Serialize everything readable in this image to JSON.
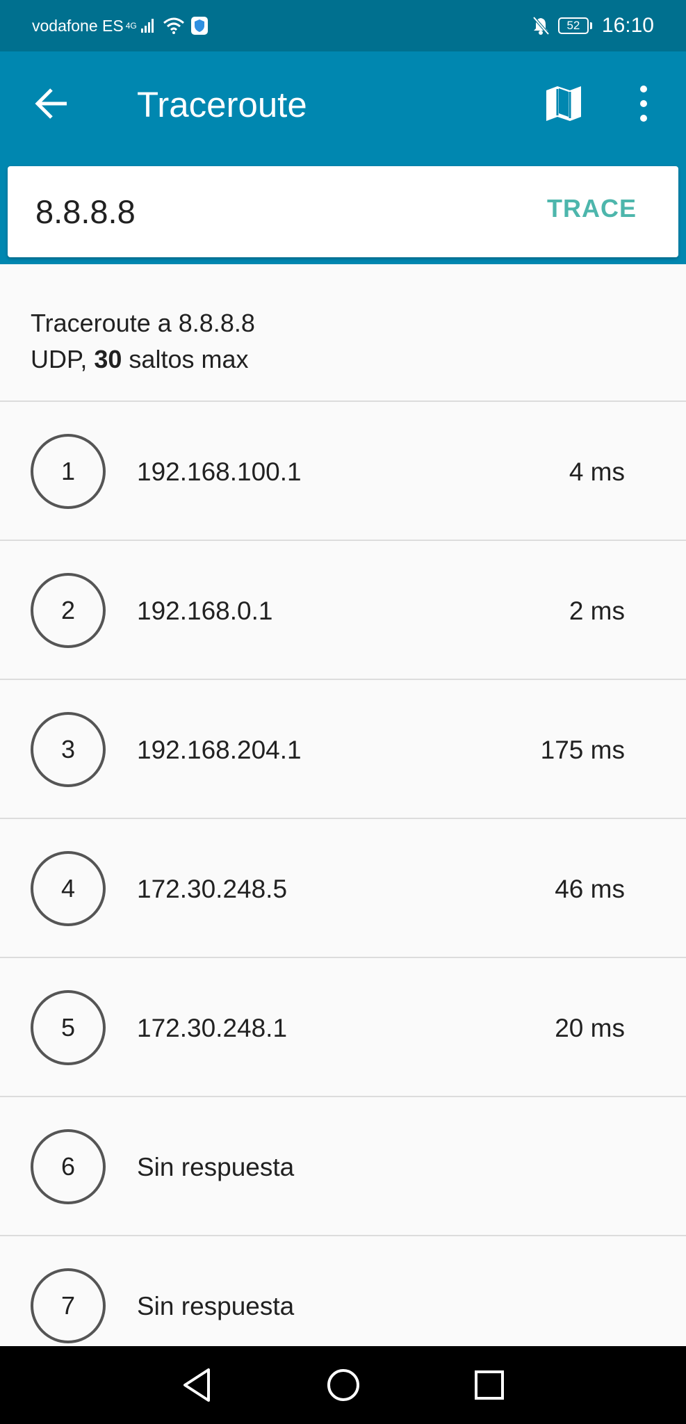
{
  "status_bar": {
    "carrier": "vodafone ES",
    "network_type": "4G",
    "battery": "52",
    "time": "16:10"
  },
  "app_bar": {
    "title": "Traceroute"
  },
  "query": {
    "host_value": "8.8.8.8",
    "trace_label": "TRACE"
  },
  "summary": {
    "title": "Traceroute a 8.8.8.8",
    "protocol": "UDP, ",
    "max_hops": "30",
    "max_hops_suffix": " saltos max"
  },
  "hops": [
    {
      "number": "1",
      "host": "192.168.100.1",
      "time": "4 ms"
    },
    {
      "number": "2",
      "host": "192.168.0.1",
      "time": "2 ms"
    },
    {
      "number": "3",
      "host": "192.168.204.1",
      "time": "175 ms"
    },
    {
      "number": "4",
      "host": "172.30.248.5",
      "time": "46 ms"
    },
    {
      "number": "5",
      "host": "172.30.248.1",
      "time": "20 ms"
    },
    {
      "number": "6",
      "host": "Sin respuesta",
      "time": ""
    },
    {
      "number": "7",
      "host": "Sin respuesta",
      "time": ""
    }
  ],
  "colors": {
    "app_bar": "#0087b0",
    "status_bar": "#00708f",
    "accent": "#4db6ac"
  }
}
